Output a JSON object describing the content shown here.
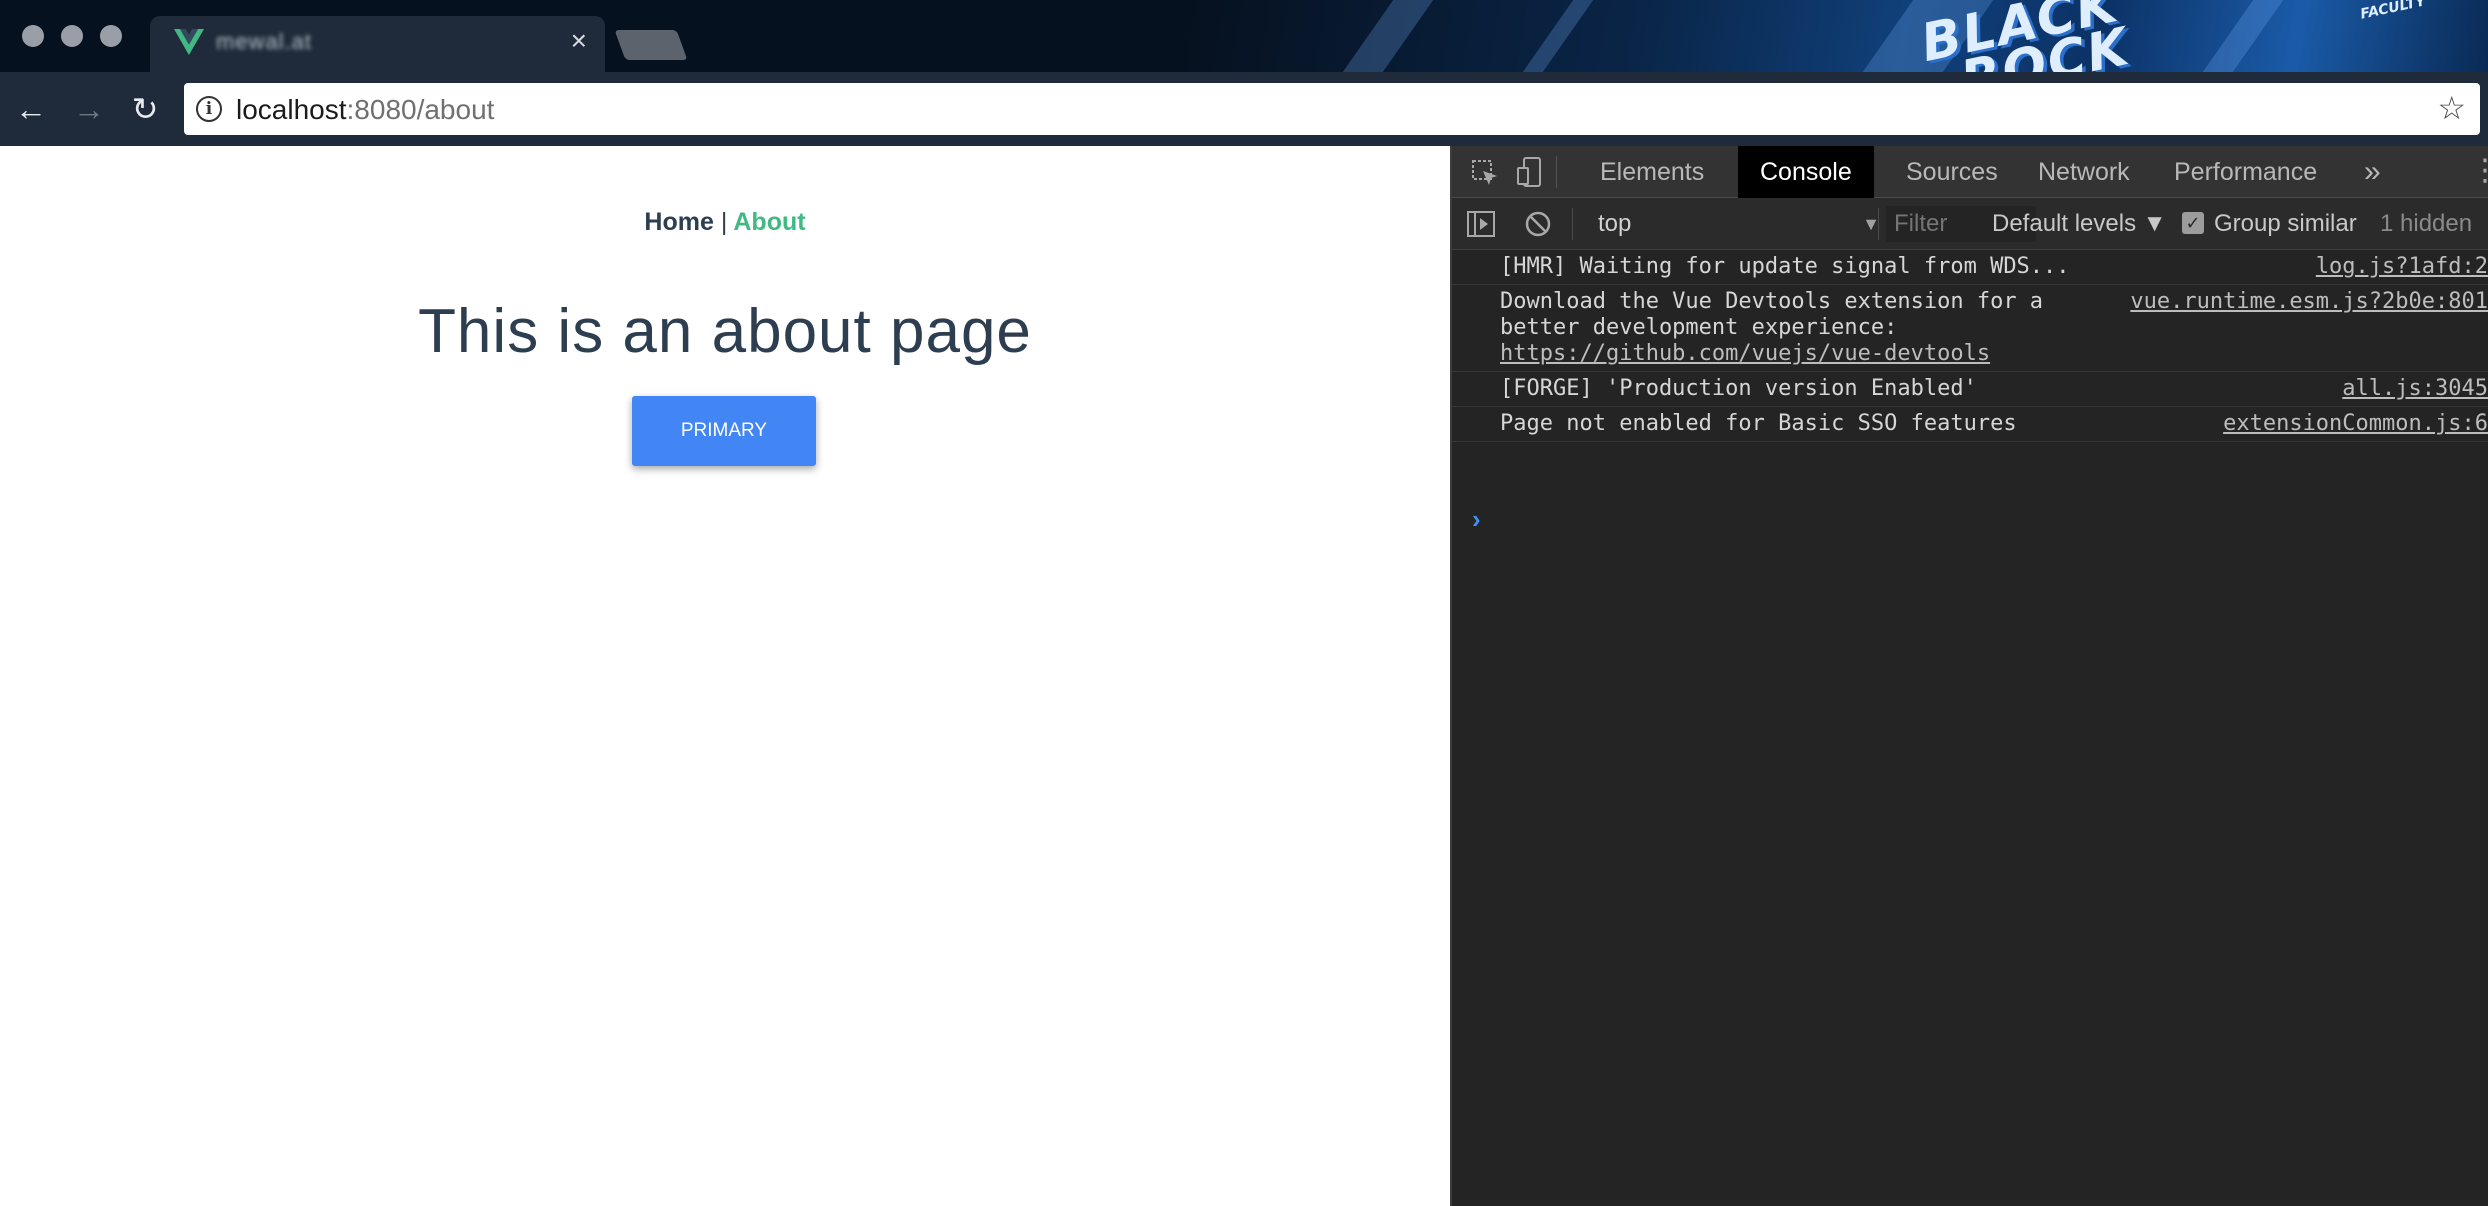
{
  "browser": {
    "tab_title": "mewal.at",
    "url_host": "localhost",
    "url_rest": ":8080/about",
    "banner_text_1": "BLACK",
    "banner_text_2": "ROCK",
    "banner_text_small": "FACULTY"
  },
  "page": {
    "nav": {
      "home": "Home",
      "separator": "|",
      "about": "About"
    },
    "heading": "This is an about page",
    "button_label": "PRIMARY"
  },
  "devtools": {
    "tabs": [
      "Elements",
      "Console",
      "Sources",
      "Network",
      "Performance"
    ],
    "active_tab": "Console",
    "more_tabs": "»",
    "context": "top",
    "filter_placeholder": "Filter",
    "levels": "Default levels ▼",
    "group_similar": "Group similar",
    "hidden_count": "1 hidden",
    "messages": [
      {
        "text": "[HMR] Waiting for update signal from WDS...",
        "source": "log.js?1afd:2"
      },
      {
        "text": "Download the Vue Devtools extension for a\nbetter development experience:",
        "link": "https://github.com/vuejs/vue-devtools",
        "source": "vue.runtime.esm.js?2b0e:801"
      },
      {
        "text": "[FORGE] 'Production version Enabled'",
        "source": "all.js:3045"
      },
      {
        "text": "Page not enabled for Basic SSO features",
        "source": "extensionCommon.js:6"
      }
    ],
    "prompt_symbol": "›"
  },
  "colors": {
    "vue_green": "#42b983",
    "text_dark": "#2c3e50",
    "primary_button": "#4285f4",
    "devtools_bg": "#242424"
  }
}
